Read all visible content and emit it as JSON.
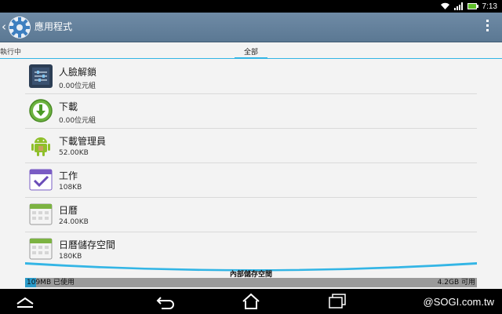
{
  "status_bar": {
    "time": "7:13"
  },
  "app_bar": {
    "title": "應用程式"
  },
  "tabs": [
    {
      "label": "執行中",
      "selected": false
    },
    {
      "label": "全部",
      "selected": true
    }
  ],
  "apps": [
    {
      "name": "人臉解鎖",
      "size": "0.00位元組",
      "icon": "face-unlock-icon"
    },
    {
      "name": "下載",
      "size": "0.00位元組",
      "icon": "download-icon"
    },
    {
      "name": "下載管理員",
      "size": "52.00KB",
      "icon": "android-icon"
    },
    {
      "name": "工作",
      "size": "108KB",
      "icon": "task-icon"
    },
    {
      "name": "日曆",
      "size": "24.00KB",
      "icon": "calendar-icon"
    },
    {
      "name": "日曆儲存空間",
      "size": "180KB",
      "icon": "calendar-storage-icon"
    }
  ],
  "storage": {
    "label": "內部儲存空間",
    "used": "109MB 已使用",
    "free": "4.2GB 可用",
    "used_fraction": 0.025
  },
  "watermark": "@SOGI.com.tw",
  "colors": {
    "accent": "#33b5e5",
    "app_bar": "#5f7c97"
  }
}
